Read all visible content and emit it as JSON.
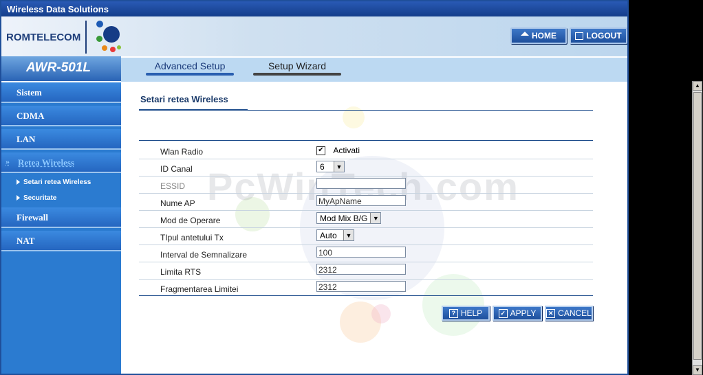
{
  "window": {
    "title": "Wireless Data Solutions"
  },
  "header": {
    "brand": "ROMTELECOM",
    "home_label": "HOME",
    "logout_label": "LOGOUT"
  },
  "sidebar": {
    "model": "AWR-501L",
    "items": [
      {
        "label": "Sistem"
      },
      {
        "label": "CDMA"
      },
      {
        "label": "LAN"
      },
      {
        "label": "Retea Wireless",
        "active": true
      },
      {
        "label": "Firewall"
      },
      {
        "label": "NAT"
      }
    ],
    "subitems": [
      {
        "label": "Setari retea Wireless"
      },
      {
        "label": "Securitate"
      }
    ]
  },
  "topnav": {
    "tabs": [
      {
        "label": "Advanced Setup"
      },
      {
        "label": "Setup Wizard",
        "active": true
      }
    ]
  },
  "content": {
    "section_title": "Setari retea Wireless",
    "watermark": "PcWinTech.com",
    "form": {
      "wlan_radio": {
        "label": "Wlan Radio",
        "checkbox_label": "Activati",
        "checked": true
      },
      "channel": {
        "label": "ID Canal",
        "value": "6"
      },
      "essid": {
        "label": "ESSID",
        "value": ""
      },
      "ap_name": {
        "label": "Nume AP",
        "value": "MyApName"
      },
      "mode": {
        "label": "Mod de Operare",
        "value": "Mod Mix B/G"
      },
      "tx_preamble": {
        "label": "TIpul antetului Tx",
        "value": "Auto"
      },
      "beacon_interval": {
        "label": "Interval de Semnalizare",
        "value": "100"
      },
      "rts_limit": {
        "label": "Limita RTS",
        "value": "2312"
      },
      "frag_limit": {
        "label": "Fragmentarea Limitei",
        "value": "2312"
      }
    },
    "buttons": {
      "help": "HELP",
      "apply": "APPLY",
      "cancel": "CANCEL"
    }
  },
  "colors": {
    "accent": "#2b7bd0",
    "title_bar": "#143d8a",
    "active_nav_text": "#8ec9ff"
  }
}
